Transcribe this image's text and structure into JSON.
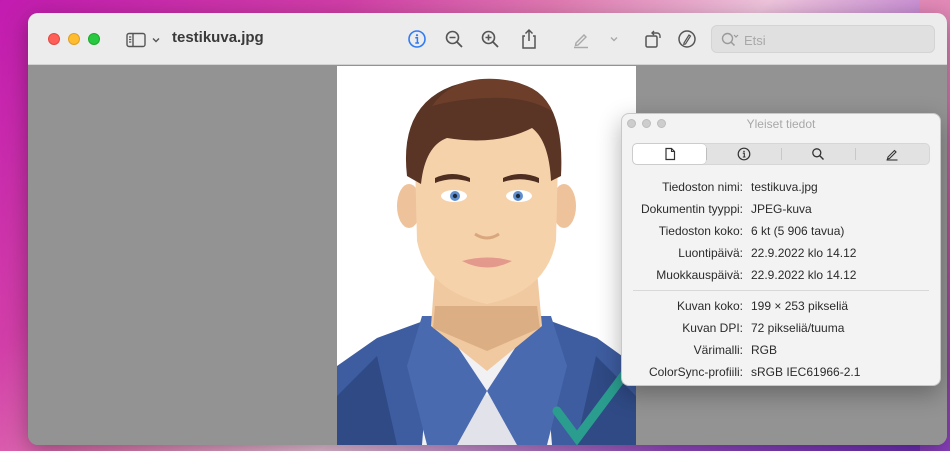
{
  "window": {
    "title": "testikuva.jpg"
  },
  "toolbar": {
    "icons": [
      "sidebar-icon",
      "chevron-down-icon",
      "info-icon",
      "zoom-out-icon",
      "zoom-in-icon",
      "share-icon",
      "markup-pen-icon",
      "chevron-down-icon",
      "rotate-icon",
      "markup-circle-icon",
      "search-icon"
    ],
    "accent_color": "#2f7bf5"
  },
  "search": {
    "placeholder": "Etsi"
  },
  "inspector": {
    "title": "Yleiset tiedot",
    "tabs": [
      "document-icon",
      "info-icon",
      "search-icon",
      "pencil-icon"
    ],
    "general": [
      {
        "label": "Tiedoston nimi:",
        "value": "testikuva.jpg"
      },
      {
        "label": "Dokumentin tyyppi:",
        "value": "JPEG-kuva"
      },
      {
        "label": "Tiedoston koko:",
        "value": "6 kt (5 906 tavua)"
      },
      {
        "label": "Luontipäivä:",
        "value": "22.9.2022 klo 14.12"
      },
      {
        "label": "Muokkauspäivä:",
        "value": "22.9.2022 klo 14.12"
      }
    ],
    "image": [
      {
        "label": "Kuvan koko:",
        "value": "199 × 253 pikseliä"
      },
      {
        "label": "Kuvan DPI:",
        "value": "72 pikseliä/tuuma"
      },
      {
        "label": "Värimalli:",
        "value": "RGB"
      },
      {
        "label": "ColorSync-profiili:",
        "value": "sRGB IEC61966-2.1"
      }
    ]
  }
}
